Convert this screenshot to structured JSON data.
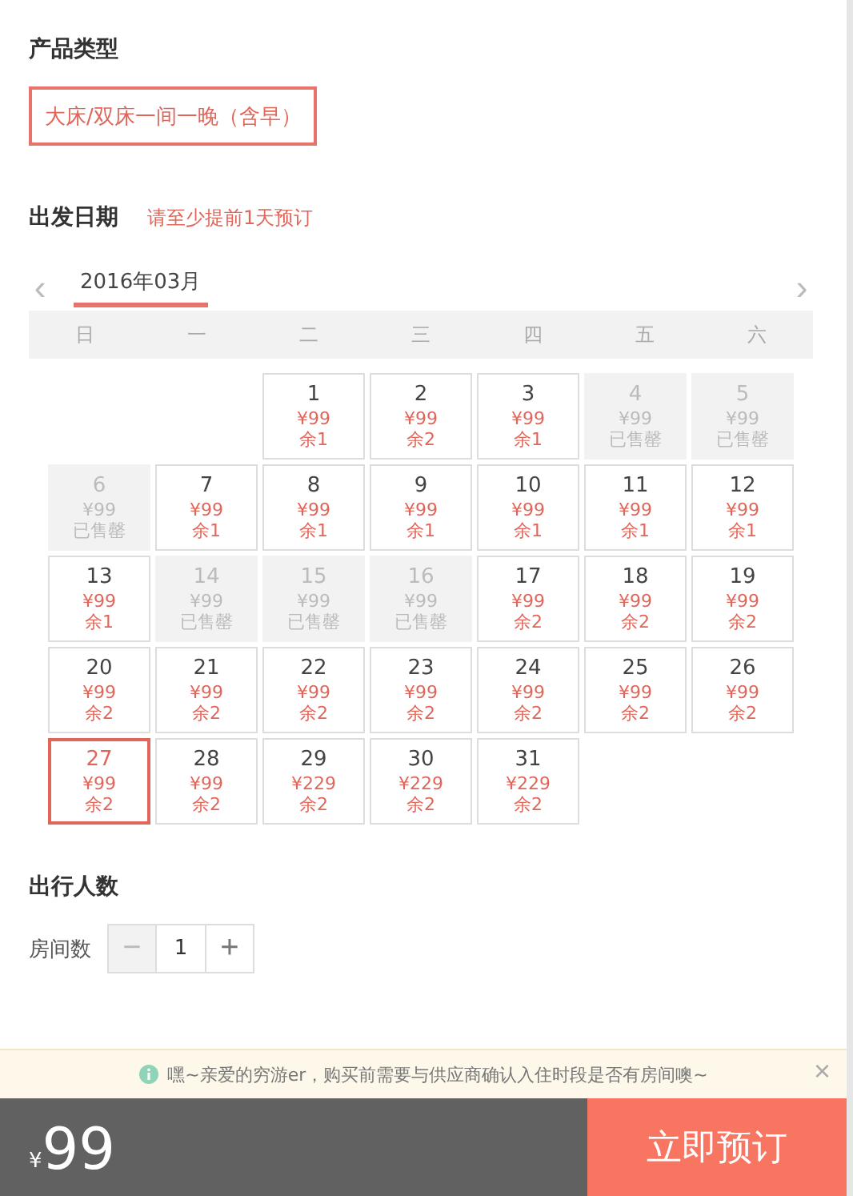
{
  "product_type": {
    "title": "产品类型",
    "options": [
      {
        "label": "大床/双床一间一晚（含早）",
        "selected": true
      }
    ]
  },
  "departure": {
    "title": "出发日期",
    "hint": "请至少提前1天预订",
    "prev": "‹",
    "next": "›",
    "month": "2016年03月",
    "weekdays": [
      "日",
      "一",
      "二",
      "三",
      "四",
      "五",
      "六"
    ],
    "days": [
      {
        "kind": "empty"
      },
      {
        "kind": "empty"
      },
      {
        "kind": "day",
        "day": "1",
        "price": "¥99",
        "status": "余1",
        "sold_out": false,
        "selected": false
      },
      {
        "kind": "day",
        "day": "2",
        "price": "¥99",
        "status": "余2",
        "sold_out": false,
        "selected": false
      },
      {
        "kind": "day",
        "day": "3",
        "price": "¥99",
        "status": "余1",
        "sold_out": false,
        "selected": false
      },
      {
        "kind": "day",
        "day": "4",
        "price": "¥99",
        "status": "已售罄",
        "sold_out": true,
        "selected": false
      },
      {
        "kind": "day",
        "day": "5",
        "price": "¥99",
        "status": "已售罄",
        "sold_out": true,
        "selected": false
      },
      {
        "kind": "day",
        "day": "6",
        "price": "¥99",
        "status": "已售罄",
        "sold_out": true,
        "selected": false
      },
      {
        "kind": "day",
        "day": "7",
        "price": "¥99",
        "status": "余1",
        "sold_out": false,
        "selected": false
      },
      {
        "kind": "day",
        "day": "8",
        "price": "¥99",
        "status": "余1",
        "sold_out": false,
        "selected": false
      },
      {
        "kind": "day",
        "day": "9",
        "price": "¥99",
        "status": "余1",
        "sold_out": false,
        "selected": false
      },
      {
        "kind": "day",
        "day": "10",
        "price": "¥99",
        "status": "余1",
        "sold_out": false,
        "selected": false
      },
      {
        "kind": "day",
        "day": "11",
        "price": "¥99",
        "status": "余1",
        "sold_out": false,
        "selected": false
      },
      {
        "kind": "day",
        "day": "12",
        "price": "¥99",
        "status": "余1",
        "sold_out": false,
        "selected": false
      },
      {
        "kind": "day",
        "day": "13",
        "price": "¥99",
        "status": "余1",
        "sold_out": false,
        "selected": false
      },
      {
        "kind": "day",
        "day": "14",
        "price": "¥99",
        "status": "已售罄",
        "sold_out": true,
        "selected": false
      },
      {
        "kind": "day",
        "day": "15",
        "price": "¥99",
        "status": "已售罄",
        "sold_out": true,
        "selected": false
      },
      {
        "kind": "day",
        "day": "16",
        "price": "¥99",
        "status": "已售罄",
        "sold_out": true,
        "selected": false
      },
      {
        "kind": "day",
        "day": "17",
        "price": "¥99",
        "status": "余2",
        "sold_out": false,
        "selected": false
      },
      {
        "kind": "day",
        "day": "18",
        "price": "¥99",
        "status": "余2",
        "sold_out": false,
        "selected": false
      },
      {
        "kind": "day",
        "day": "19",
        "price": "¥99",
        "status": "余2",
        "sold_out": false,
        "selected": false
      },
      {
        "kind": "day",
        "day": "20",
        "price": "¥99",
        "status": "余2",
        "sold_out": false,
        "selected": false
      },
      {
        "kind": "day",
        "day": "21",
        "price": "¥99",
        "status": "余2",
        "sold_out": false,
        "selected": false
      },
      {
        "kind": "day",
        "day": "22",
        "price": "¥99",
        "status": "余2",
        "sold_out": false,
        "selected": false
      },
      {
        "kind": "day",
        "day": "23",
        "price": "¥99",
        "status": "余2",
        "sold_out": false,
        "selected": false
      },
      {
        "kind": "day",
        "day": "24",
        "price": "¥99",
        "status": "余2",
        "sold_out": false,
        "selected": false
      },
      {
        "kind": "day",
        "day": "25",
        "price": "¥99",
        "status": "余2",
        "sold_out": false,
        "selected": false
      },
      {
        "kind": "day",
        "day": "26",
        "price": "¥99",
        "status": "余2",
        "sold_out": false,
        "selected": false
      },
      {
        "kind": "day",
        "day": "27",
        "price": "¥99",
        "status": "余2",
        "sold_out": false,
        "selected": true
      },
      {
        "kind": "day",
        "day": "28",
        "price": "¥99",
        "status": "余2",
        "sold_out": false,
        "selected": false
      },
      {
        "kind": "day",
        "day": "29",
        "price": "¥229",
        "status": "余2",
        "sold_out": false,
        "selected": false
      },
      {
        "kind": "day",
        "day": "30",
        "price": "¥229",
        "status": "余2",
        "sold_out": false,
        "selected": false
      },
      {
        "kind": "day",
        "day": "31",
        "price": "¥229",
        "status": "余2",
        "sold_out": false,
        "selected": false
      }
    ]
  },
  "travelers": {
    "title": "出行人数",
    "label": "房间数",
    "minus": "−",
    "value": "1",
    "plus": "+",
    "minus_disabled": true
  },
  "notice": {
    "text": "嘿~亲爱的穷游er，购买前需要与供应商确认入住时段是否有房间噢~",
    "close": "×"
  },
  "footer": {
    "currency": "¥",
    "price": "99",
    "button": "立即预订"
  }
}
